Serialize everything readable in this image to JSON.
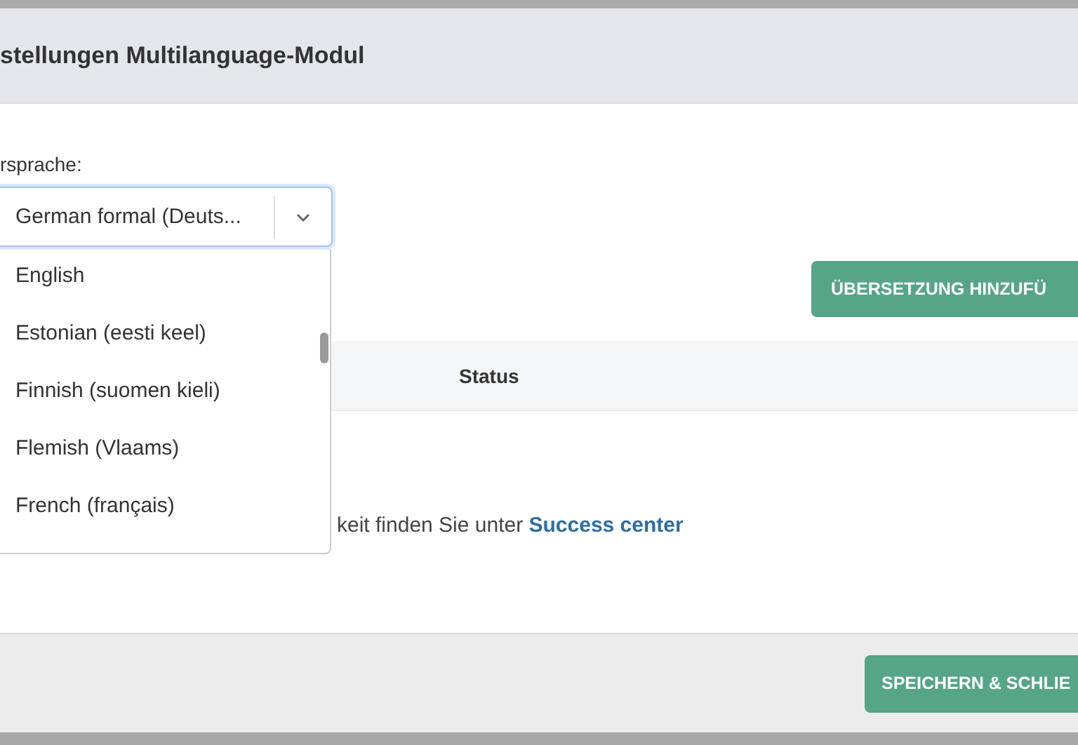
{
  "dialog": {
    "title": "stellungen Multilanguage-Modul"
  },
  "language_field": {
    "label": "rsprache:",
    "value": "German formal (Deuts...",
    "expanded": true,
    "options": [
      {
        "label": "English",
        "selected": false
      },
      {
        "label": "Estonian (eesti keel)",
        "selected": false
      },
      {
        "label": "Finnish (suomen kieli)",
        "selected": false
      },
      {
        "label": "Flemish (Vlaams)",
        "selected": false
      },
      {
        "label": "French (français)",
        "selected": false
      }
    ]
  },
  "add_button": "ÜBERSETZUNG HINZUFÜ",
  "table": {
    "columns": [
      "Status"
    ]
  },
  "help": {
    "text": "keit finden Sie unter ",
    "link": "Success center"
  },
  "footer": {
    "save_button": "SPEICHERN & SCHLIE"
  }
}
